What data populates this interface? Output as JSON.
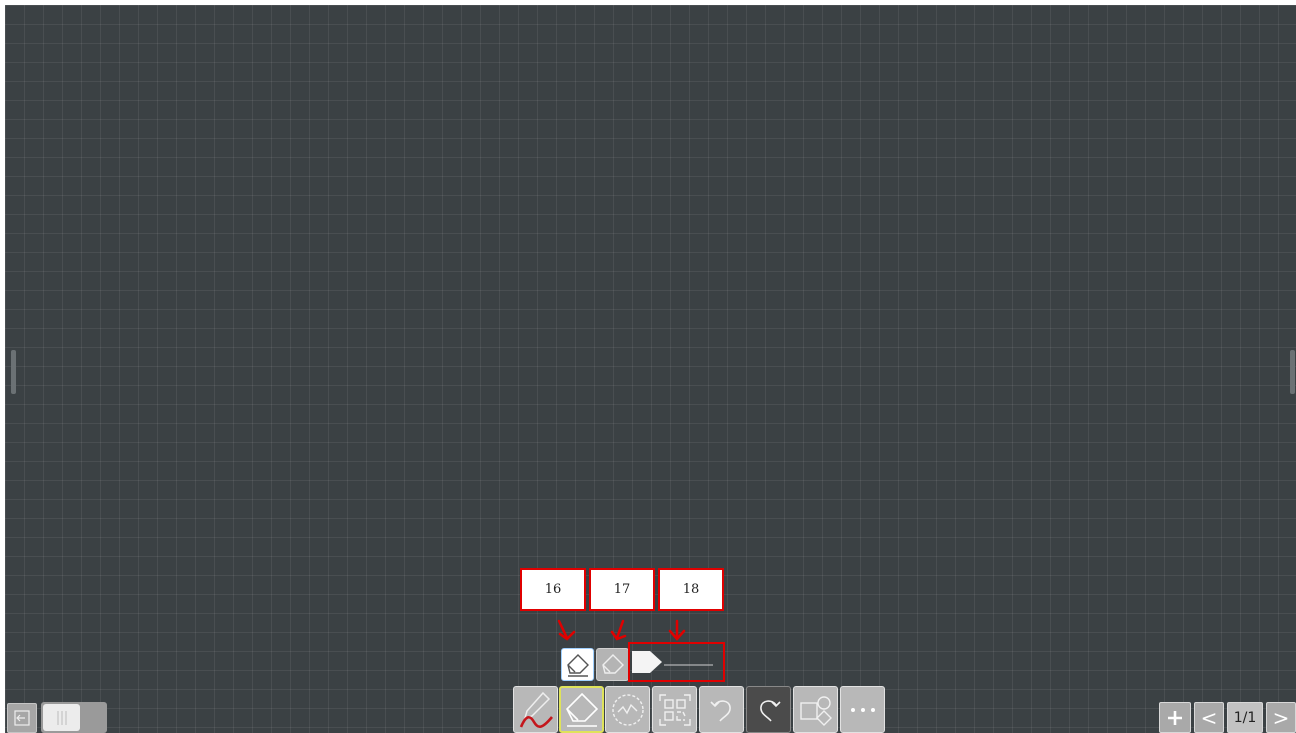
{
  "callouts": [
    {
      "label": "16"
    },
    {
      "label": "17"
    },
    {
      "label": "18"
    }
  ],
  "toolbar": {
    "tools": [
      {
        "name": "pen",
        "icon": "pen-icon",
        "ink_color": "#c4161c"
      },
      {
        "name": "eraser",
        "icon": "eraser-icon",
        "active": true
      },
      {
        "name": "select",
        "icon": "select-icon"
      },
      {
        "name": "qr-code",
        "icon": "qr-code-icon"
      },
      {
        "name": "undo",
        "icon": "undo-icon"
      },
      {
        "name": "redo",
        "icon": "redo-icon"
      },
      {
        "name": "shapes",
        "icon": "shapes-icon"
      },
      {
        "name": "more",
        "icon": "more-icon"
      }
    ]
  },
  "eraser_options": {
    "small_eraser_icon": "eraser-icon",
    "large_eraser_icon": "eraser-icon",
    "size_slider_icon": "arrow-pointer-icon"
  },
  "pager": {
    "add_icon": "plus-icon",
    "prev_label": "<",
    "page_indicator": "1/1",
    "next_label": ">"
  },
  "colors": {
    "board": "#3b4144",
    "annotation": "#e00000",
    "active_tool_border": "#dfe35a"
  }
}
